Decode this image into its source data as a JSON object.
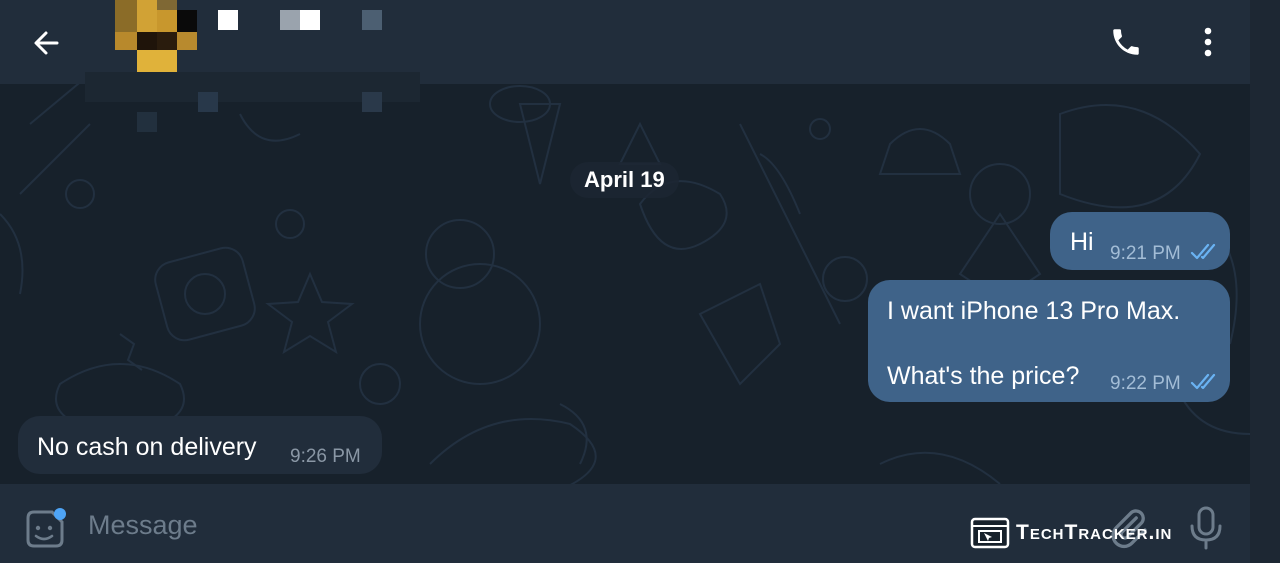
{
  "date_separator": "April 19",
  "messages": [
    {
      "direction": "outgoing",
      "text": "Hi",
      "time": "9:21 PM",
      "status": "read"
    },
    {
      "direction": "outgoing",
      "lines": [
        "I want iPhone 13 Pro Max.",
        "What's the price?"
      ],
      "time": "9:22 PM",
      "status": "read"
    },
    {
      "direction": "incoming",
      "text": "No cash on delivery",
      "time": "9:26 PM"
    }
  ],
  "composer": {
    "placeholder": "Message"
  },
  "watermark": "TechTracker.in",
  "icons": {
    "back": "arrow-left-icon",
    "call": "phone-icon",
    "menu": "more-vertical-icon",
    "sticker": "sticker-icon",
    "attach": "paperclip-icon",
    "mic": "microphone-icon",
    "read": "double-check-icon"
  },
  "colors": {
    "header_bg": "#212d3b",
    "chat_bg": "#17212b",
    "outgoing_bubble": "#3f6389",
    "incoming_bubble": "#212d3b",
    "read_tick": "#6ab3f3",
    "notification_dot": "#4ea4f6"
  }
}
